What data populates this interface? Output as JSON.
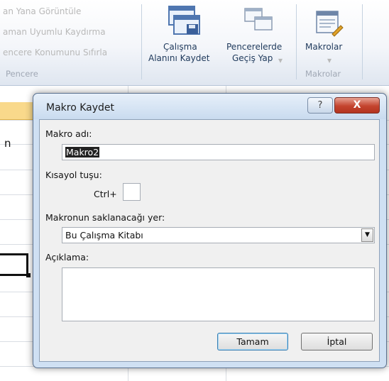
{
  "ribbon": {
    "window_items": [
      "an Yana Görüntüle",
      "aman Uyumlu Kaydırma",
      "encere Konumunu Sıfırla"
    ],
    "group_window": "Pencere",
    "save_workspace_line1": "Çalışma",
    "save_workspace_line2": "Alanını Kaydet",
    "switch_windows_line1": "Pencerelerde",
    "switch_windows_line2": "Geçiş Yap",
    "dropdown_arrow": "▾",
    "macros_label": "Makrolar",
    "group_macros": "Makrolar"
  },
  "sheet": {
    "cell_text": "n"
  },
  "dialog": {
    "title": "Makro Kaydet",
    "help_glyph": "?",
    "close_glyph": "X",
    "macro_name_label": "Makro adı:",
    "macro_name_value": "Makro2",
    "shortcut_label": "Kısayol tuşu:",
    "ctrl_label": "Ctrl+",
    "shortcut_value": "",
    "store_label": "Makronun saklanacağı yer:",
    "store_value": "Bu Çalışma Kitabı",
    "description_label": "Açıklama:",
    "description_value": "",
    "ok_label": "Tamam",
    "cancel_label": "İptal"
  },
  "colors": {
    "dialog_bg": "#cfe0f3",
    "close_red": "#c4432e",
    "column_header_orange": "#f9d98b"
  }
}
